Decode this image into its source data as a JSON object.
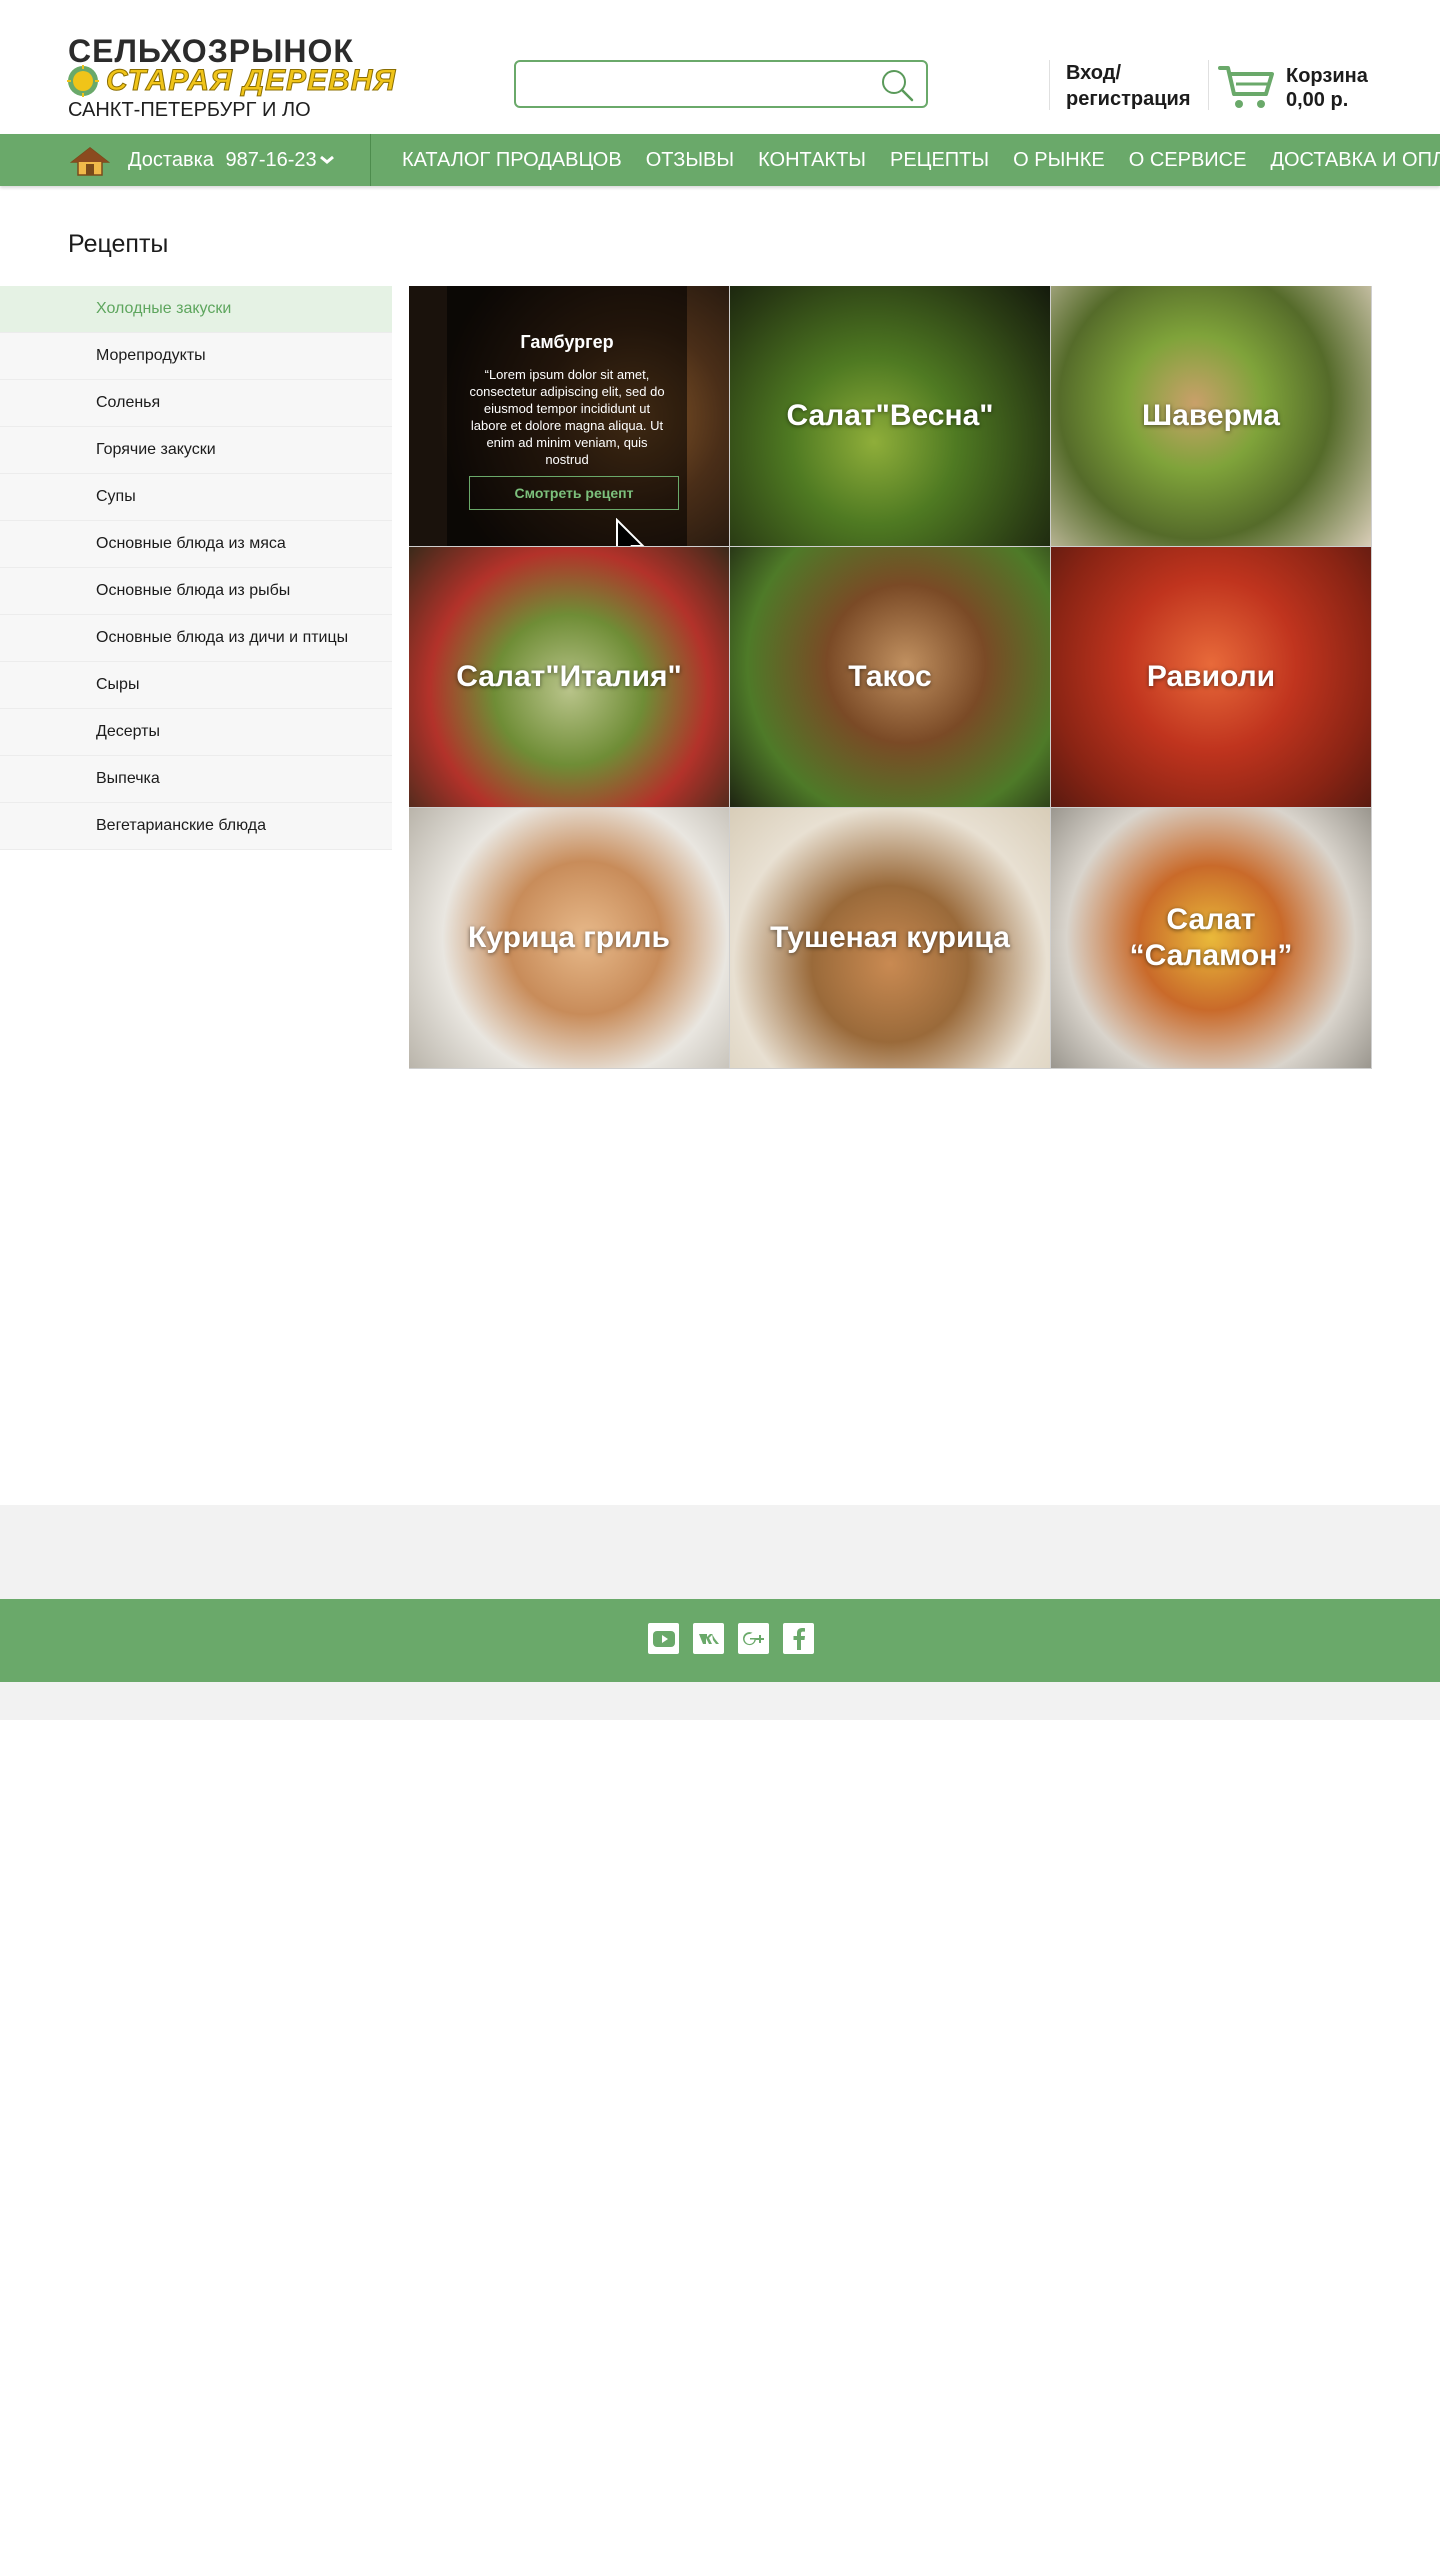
{
  "header": {
    "logo": {
      "line1": "СЕЛЬХОЗРЫНОК",
      "line2": "СТАРАЯ ДЕРЕВНЯ",
      "line3": "САНКТ-ПЕТЕРБУРГ И ЛО"
    },
    "search": {
      "value": "",
      "placeholder": "",
      "icon": "search-icon"
    },
    "login": "Вход/\nрегистрация",
    "cart": {
      "label": "Корзина",
      "amount": "0,00 р.",
      "icon": "cart-icon"
    }
  },
  "navbar": {
    "home_icon": "home-icon",
    "delivery_label": "Доставка",
    "delivery_phone": "987-16-23",
    "items": [
      {
        "label": "КАТАЛОГ ПРОДАВЦОВ"
      },
      {
        "label": "ОТЗЫВЫ"
      },
      {
        "label": "КОНТАКТЫ"
      },
      {
        "label": "РЕЦЕПТЫ"
      },
      {
        "label": "О РЫНКЕ"
      },
      {
        "label": "О СЕРВИСЕ"
      },
      {
        "label": "ДОСТАВКА И ОПЛАТА"
      }
    ]
  },
  "page": {
    "title": "Рецепты"
  },
  "sidebar": {
    "items": [
      {
        "label": "Холодные закуски",
        "active": true
      },
      {
        "label": "Морепродукты"
      },
      {
        "label": "Соленья"
      },
      {
        "label": "Горячие закуски"
      },
      {
        "label": "Супы"
      },
      {
        "label": "Основные блюда из мяса"
      },
      {
        "label": "Основные блюда из рыбы"
      },
      {
        "label": "Основные блюда из дичи и птицы"
      },
      {
        "label": "Сыры"
      },
      {
        "label": "Десерты"
      },
      {
        "label": "Выпечка"
      },
      {
        "label": "Вегетарианские блюда"
      }
    ]
  },
  "recipes": {
    "hovered": {
      "title": "Гамбургер",
      "text": "“Lorem ipsum dolor sit amet, consectetur adipiscing elit, sed do eiusmod tempor incididunt ut labore et dolore magna aliqua. Ut enim ad minim veniam, quis nostrud",
      "button": "Смотреть рецепт"
    },
    "tiles": [
      {
        "title": "Салат\"Весна\""
      },
      {
        "title": "Шаверма"
      },
      {
        "title": "Салат\"Италия\""
      },
      {
        "title": "Такос"
      },
      {
        "title": "Равиоли"
      },
      {
        "title": "Курица гриль"
      },
      {
        "title": "Тушеная курица"
      },
      {
        "title": "Салат\n“Саламон”"
      }
    ]
  },
  "footer": {
    "socials": [
      "youtube-icon",
      "vk-icon",
      "google-plus-icon",
      "facebook-icon"
    ]
  },
  "colors": {
    "brand_green": "#6aa96a",
    "active_bg": "#e5f2e4",
    "logo_yellow": "#f0c419"
  }
}
